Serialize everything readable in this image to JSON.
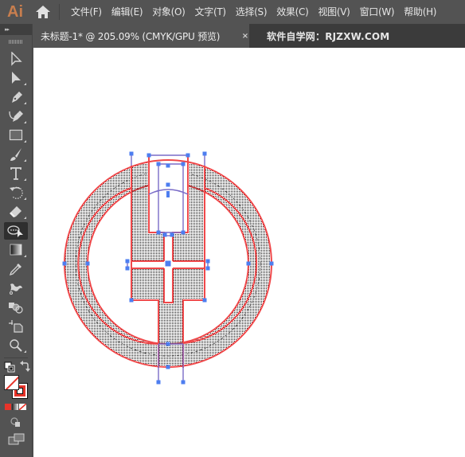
{
  "app": {
    "logo": "Ai",
    "logo_color": "#c87e4e"
  },
  "menu": {
    "items": [
      {
        "label": "文件(F)"
      },
      {
        "label": "编辑(E)"
      },
      {
        "label": "对象(O)"
      },
      {
        "label": "文字(T)"
      },
      {
        "label": "选择(S)"
      },
      {
        "label": "效果(C)"
      },
      {
        "label": "视图(V)"
      },
      {
        "label": "窗口(W)"
      },
      {
        "label": "帮助(H)"
      }
    ]
  },
  "tabs": {
    "document": "未标题-1* @ 205.09% (CMYK/GPU 预览)",
    "close_glyph": "×",
    "second": "软件自学网：RJZXW.COM"
  },
  "toolbar": {
    "collapse_glyph": "▸▸",
    "tools": [
      {
        "name": "selection-tool",
        "icon": "hollow-arrow-icon"
      },
      {
        "name": "direct-selection-tool",
        "icon": "solid-arrow-icon"
      },
      {
        "name": "pen-tool",
        "icon": "pen-icon"
      },
      {
        "name": "curvature-tool",
        "icon": "curvature-pen-icon"
      },
      {
        "name": "rectangle-tool",
        "icon": "rectangle-icon"
      },
      {
        "name": "paintbrush-tool",
        "icon": "brush-icon"
      },
      {
        "name": "type-tool",
        "icon": "type-icon"
      },
      {
        "name": "rotate-tool",
        "icon": "rotate-icon"
      },
      {
        "name": "eraser-tool",
        "icon": "eraser-icon"
      },
      {
        "name": "lasso-tool",
        "icon": "lasso-icon",
        "active": true
      },
      {
        "name": "gradient-tool",
        "icon": "gradient-icon"
      },
      {
        "name": "eyedropper-tool",
        "icon": "eyedropper-icon"
      },
      {
        "name": "puppet-warp-tool",
        "icon": "puppet-warp-icon"
      },
      {
        "name": "shape-builder-tool",
        "icon": "shape-builder-icon"
      },
      {
        "name": "artboard-tool",
        "icon": "artboard-icon"
      },
      {
        "name": "zoom-tool",
        "icon": "magnifier-icon"
      }
    ],
    "fill_color": "none",
    "stroke_color": "#e8342a",
    "color_mode_swatch": "#e8342a"
  },
  "artwork": {
    "stroke_color": "#f0484a",
    "path_color": "#7a6cc8",
    "anchor_color": "#4d7ef0",
    "fill_pattern": "dots"
  }
}
